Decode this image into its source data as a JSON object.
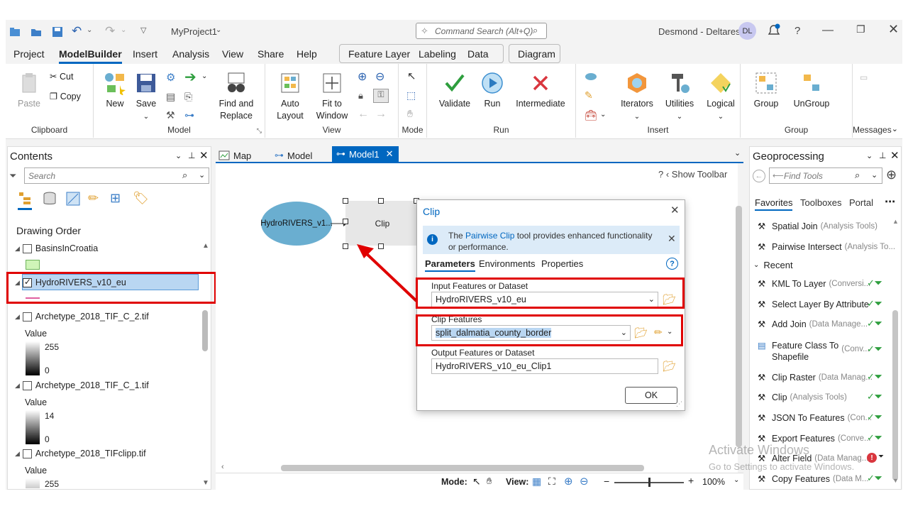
{
  "app": {
    "project": "MyProject1",
    "search_placeholder": "Command Search (Alt+Q)",
    "user": "Desmond - Deltares",
    "avatar": "DL",
    "help": "?"
  },
  "menu": [
    "Project",
    "ModelBuilder",
    "Insert",
    "Analysis",
    "View",
    "Share",
    "Help"
  ],
  "context_tabs": [
    "Feature Layer",
    "Labeling",
    "Data"
  ],
  "diagram_tab": "Diagram",
  "ribbon": {
    "clipboard": {
      "paste": "Paste",
      "cut": "Cut",
      "copy": "Copy",
      "label": "Clipboard"
    },
    "model": {
      "new": "New",
      "save": "Save",
      "find_replace_1": "Find and",
      "find_replace_2": "Replace",
      "label": "Model"
    },
    "view": {
      "auto_1": "Auto",
      "auto_2": "Layout",
      "fit_1": "Fit to",
      "fit_2": "Window",
      "label": "View"
    },
    "mode": {
      "label": "Mode"
    },
    "run": {
      "validate": "Validate",
      "run": "Run",
      "intermediate": "Intermediate",
      "label": "Run"
    },
    "insert": {
      "iterators": "Iterators",
      "utilities": "Utilities",
      "logical": "Logical",
      "label": "Insert"
    },
    "group": {
      "group": "Group",
      "ungroup": "UnGroup",
      "label": "Group"
    },
    "messages": {
      "label": "Messages"
    }
  },
  "contents": {
    "title": "Contents",
    "search_placeholder": "Search",
    "drawing_order": "Drawing Order",
    "layers": {
      "l1": "BasinsInCroatia",
      "l2": "HydroRIVERS_v10_eu",
      "l3": "Archetype_2018_TIF_C_2.tif",
      "l3_value": "Value",
      "l3_max": "255",
      "l3_min": "0",
      "l4": "Archetype_2018_TIF_C_1.tif",
      "l4_value": "Value",
      "l4_max": "14",
      "l4_min": "0",
      "l5": "Archetype_2018_TIFclipp.tif",
      "l5_value": "Value",
      "l5_max": "255"
    }
  },
  "tabs": {
    "map": "Map",
    "model": "Model",
    "model1": "Model1",
    "show_toolbar": "Show Toolbar"
  },
  "canvas": {
    "node_input": "HydroRIVERS_v1...",
    "node_tool": "Clip"
  },
  "status": {
    "mode": "Mode:",
    "view": "View:",
    "zoom": "100%"
  },
  "dialog": {
    "title": "Clip",
    "info_pre": "The ",
    "info_link": "Pairwise Clip",
    "info_post": " tool provides enhanced functionality or performance.",
    "tabs": [
      "Parameters",
      "Environments",
      "Properties"
    ],
    "input_label": "Input Features or Dataset",
    "input_value": "HydroRIVERS_v10_eu",
    "clip_label": "Clip Features",
    "clip_value": "split_dalmatia_county_border",
    "output_label": "Output Features or Dataset",
    "output_value": "HydroRIVERS_v10_eu_Clip1",
    "ok": "OK"
  },
  "geoprocessing": {
    "title": "Geoprocessing",
    "find_placeholder": "Find Tools",
    "tabs": [
      "Favorites",
      "Toolboxes",
      "Portal"
    ],
    "favorites": [
      {
        "name": "Spatial Join",
        "box": "(Analysis Tools)"
      },
      {
        "name": "Pairwise Intersect",
        "box": "(Analysis To..."
      }
    ],
    "recent_label": "Recent",
    "recent": [
      {
        "name": "KML To Layer",
        "box": "(Conversi..."
      },
      {
        "name": "Select Layer By Attribute",
        "box": ""
      },
      {
        "name": "Add Join",
        "box": "(Data Manage..."
      },
      {
        "name": "Feature Class To",
        "name2": "Shapefile",
        "box": "(Conv..."
      },
      {
        "name": "Clip Raster",
        "box": "(Data Manag..."
      },
      {
        "name": "Clip",
        "box": "(Analysis Tools)"
      },
      {
        "name": "JSON To Features",
        "box": "(Con..."
      },
      {
        "name": "Export Features",
        "box": "(Conve..."
      },
      {
        "name": "Alter Field",
        "box": "(Data Manag..."
      },
      {
        "name": "Copy Features",
        "box": "(Data M..."
      }
    ]
  },
  "watermark": {
    "line1": "Activate Windows",
    "line2": "Go to Settings to activate Windows."
  },
  "colors": {
    "accent": "#0067c0",
    "highlight": "#b9d6f2",
    "red": "#e00000",
    "input_node": "#6aaed0",
    "green": "#2e9e3e"
  }
}
